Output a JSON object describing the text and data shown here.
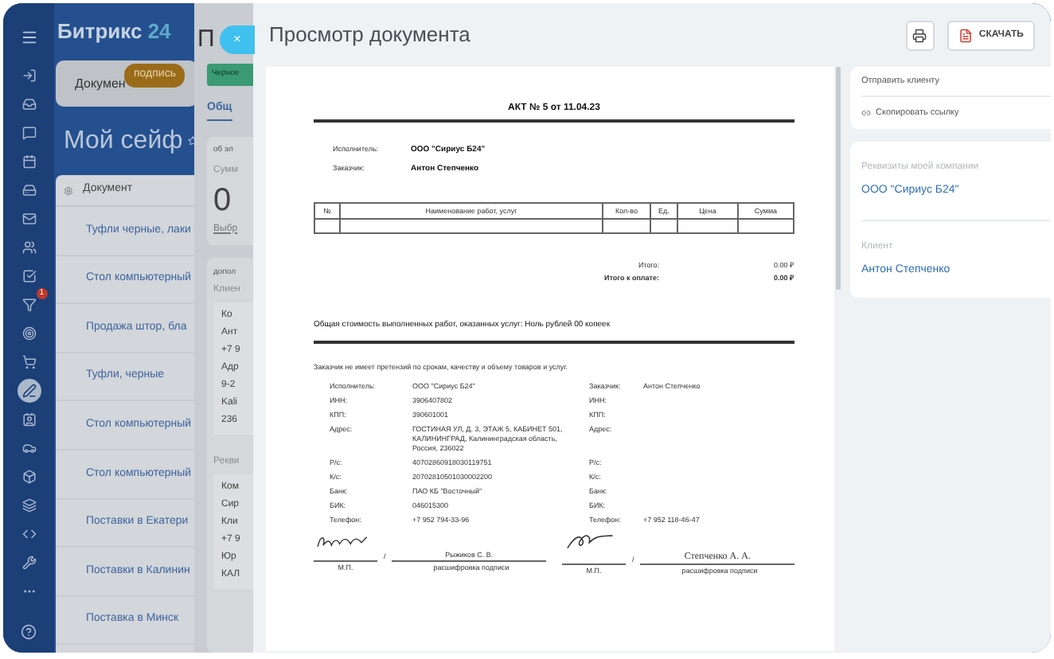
{
  "sidebar": {
    "logo": "Битрикс",
    "logo_number": "24",
    "items": [
      {
        "selected": false
      },
      {
        "selected": false
      },
      {
        "selected": false
      },
      {
        "selected": false
      },
      {
        "selected": false
      },
      {
        "selected": false
      },
      {
        "selected": false
      },
      {
        "selected": false
      },
      {
        "selected": false,
        "badge": "1"
      },
      {
        "selected": false
      },
      {
        "selected": false
      },
      {
        "selected": true
      },
      {
        "selected": false
      },
      {
        "selected": false
      },
      {
        "selected": false
      },
      {
        "selected": false
      },
      {
        "selected": false
      },
      {
        "selected": false
      },
      {
        "selected": false
      }
    ]
  },
  "background": {
    "tab": "Докумен",
    "tab_badge": "подпись",
    "page_title": "Мой сейф",
    "list": {
      "header": "Документ",
      "rows": [
        "Туфли черные, лаки",
        "Стол компьютерный",
        "Продажа штор, бла",
        "Туфли, черные",
        "Стол компьютерный",
        "Стол компьютерный",
        "Поставки в Екатери",
        "Поставки в Калинин",
        "Поставка в Минск"
      ]
    }
  },
  "middle_panel": {
    "title": "П",
    "stage": "Черное",
    "tab": "Общ",
    "section_title": "об эл",
    "sum_label": "Сумм",
    "sum_value": "0",
    "sum_link": "Выбр",
    "extra_title": "допол",
    "client_label": "Клиен",
    "client_lines": [
      "Ко",
      "Ант",
      "+7 9",
      "Адр",
      "9-2",
      "Kali",
      "236"
    ],
    "requisites_label": "Рекви",
    "requisites_lines": [
      "Ком",
      "Сир",
      "Кли",
      "+7 9",
      "Юр",
      "КАЛ"
    ]
  },
  "viewer": {
    "close": "×",
    "title": "Просмотр документа",
    "download": "СКАЧАТЬ",
    "actions": [
      "Отправить клиенту",
      "Скопировать ссылку"
    ],
    "details": [
      {
        "label": "Реквизиты моей компании",
        "value": "ООО \"Сириус Б24\""
      },
      {
        "label": "Клиент",
        "value": "Антон Степченко"
      }
    ]
  },
  "document": {
    "title": "АКТ № 5 от 11.04.23",
    "parties": [
      {
        "label": "Исполнитель:",
        "value": "ООО \"Сириус Б24\""
      },
      {
        "label": "Заказчик:",
        "value": "Антон Степченко"
      }
    ],
    "table": {
      "columns": [
        "№",
        "Наименование работ, услуг",
        "Кол-во",
        "Ед.",
        "Цена",
        "Сумма"
      ]
    },
    "totals": [
      {
        "label": "Итого:",
        "value": "0.00 ₽",
        "bold": false
      },
      {
        "label": "Итого к оплате:",
        "value": "0.00 ₽",
        "bold": true
      }
    ],
    "amount_in_words": "Общая стоимость выполненных работ, оказанных услуг: Ноль рублей 00 копеек",
    "claims_note": "Заказчик не имеет претензий по срокам, качеству и объему товаров и услуг.",
    "requisites": [
      {
        "label": "Исполнитель:",
        "value": "ООО \"Сириус Б24\"",
        "label_2": "Заказчик:",
        "value_2": "Антон Степченко"
      },
      {
        "label": "ИНН:",
        "value": "3906407802",
        "label_2": "ИНН:"
      },
      {
        "label": "КПП:",
        "value": "390601001",
        "label_2": "КПП:"
      },
      {
        "label": "Адрес:",
        "value": "ГОСТИНАЯ УЛ, Д. 3, ЭТАЖ 5, КАБИНЕТ 501, КАЛИНИНГРАД, Калининградская область, Россия, 236022",
        "label_2": "Адрес:"
      },
      {
        "label": "Р/с:",
        "value": "40702860918030119751",
        "label_2": "Р/с:"
      },
      {
        "label": "К/с:",
        "value": "20702810501030002200",
        "label_2": "К/с:"
      },
      {
        "label": "Банк:",
        "value": "ПАО КБ \"Восточный\"",
        "label_2": "Банк:"
      },
      {
        "label": "БИК:",
        "value": "046015300",
        "label_2": "БИК:"
      },
      {
        "label": "Телефон:",
        "value": "+7 952 794-33-96",
        "label_2": "Телефон:",
        "value_2": "+7 952 118-46-47"
      }
    ],
    "signatures": [
      {
        "stamp": "М.П.",
        "slash": "/",
        "name": "Рыжиков С. В.",
        "caption": "расшифровка подписи"
      },
      {
        "stamp": "М.П.",
        "slash": "/",
        "name": "Степченко А. А.",
        "caption": "расшифровка подписи"
      }
    ]
  }
}
